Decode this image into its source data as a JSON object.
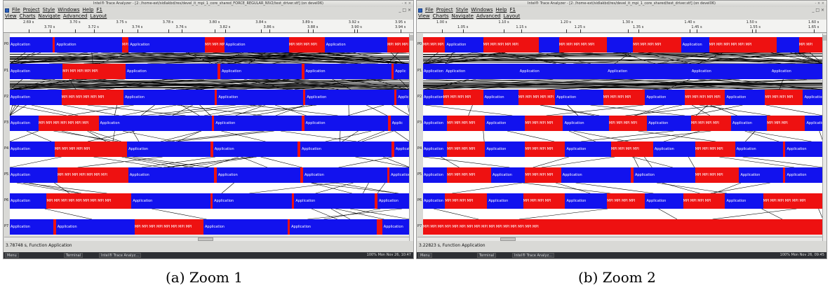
{
  "panels": [
    {
      "id": "a",
      "window_title": "Intel® Trace Analyzer - [2: /home-ext/sidlakbd/res/devel_it_mpi_1_core_shared_FORCE_REGULAR_NIV2/test_driver.stf] (on devel06)",
      "window_buttons": "- × ×",
      "menus": [
        {
          "label": "File"
        },
        {
          "label": "Project"
        },
        {
          "label": "Style"
        },
        {
          "label": "Windows"
        },
        {
          "label": "Help"
        },
        {
          "label": "F1"
        }
      ],
      "menu_right": "_ □ ×",
      "chart_menus": [
        {
          "label": "View"
        },
        {
          "label": "Charts"
        },
        {
          "label": "Navigate"
        },
        {
          "label": "Advanced"
        },
        {
          "label": "Layout"
        }
      ],
      "ruler_up": [
        "2.69 s",
        "3.70 s",
        "3.75 s",
        "3.78 s",
        "3.80 s",
        "3.84 s",
        "3.89 s",
        "3.92 s",
        "3.95 s"
      ],
      "ruler_down": [
        "3.70 s",
        "3.72 s",
        "3.74 s",
        "3.76 s",
        "3.82 s",
        "3.86 s",
        "3.88 s",
        "3.90 s",
        "3.94 s"
      ],
      "rows": [
        {
          "label": "P0",
          "segments": [
            {
              "s": 0.107,
              "e": 0.113,
              "t": ""
            },
            {
              "s": 0.281,
              "e": 0.297,
              "t": "MPI"
            },
            {
              "s": 0.488,
              "e": 0.536,
              "t": "MPI MPI MPI"
            },
            {
              "s": 0.698,
              "e": 0.787,
              "t": "MPI MPI MPI MPI"
            },
            {
              "s": 0.944,
              "e": 1.0,
              "t": "MPI MPI MPI"
            }
          ],
          "apps": [
            {
              "x": 0.0,
              "t": "Application"
            },
            {
              "x": 0.115,
              "t": "Application"
            },
            {
              "x": 0.299,
              "t": "Application"
            },
            {
              "x": 0.538,
              "t": "Application"
            },
            {
              "x": 0.789,
              "t": "Application"
            }
          ]
        },
        {
          "label": "P1",
          "segments": [
            {
              "s": 0.132,
              "e": 0.289,
              "t": "MPI MPI MPI MPI MPI"
            },
            {
              "s": 0.52,
              "e": 0.526,
              "t": ""
            },
            {
              "s": 0.73,
              "e": 0.736,
              "t": ""
            },
            {
              "s": 0.954,
              "e": 0.96,
              "t": ""
            }
          ],
          "apps": [
            {
              "x": 0.0,
              "t": "Application"
            },
            {
              "x": 0.291,
              "t": "Application"
            },
            {
              "x": 0.528,
              "t": "Application"
            },
            {
              "x": 0.738,
              "t": "Application"
            },
            {
              "x": 0.962,
              "t": "Applic"
            }
          ]
        },
        {
          "label": "P2",
          "segments": [
            {
              "s": 0.129,
              "e": 0.284,
              "t": "MPI MPI MPI MPI MPI MPI"
            },
            {
              "s": 0.512,
              "e": 0.518,
              "t": ""
            },
            {
              "s": 0.733,
              "e": 0.739,
              "t": ""
            },
            {
              "s": 0.961,
              "e": 0.967,
              "t": ""
            }
          ],
          "apps": [
            {
              "x": 0.0,
              "t": "Application"
            },
            {
              "x": 0.286,
              "t": "Application"
            },
            {
              "x": 0.52,
              "t": "Application"
            },
            {
              "x": 0.741,
              "t": "Application"
            },
            {
              "x": 0.969,
              "t": "Applic"
            }
          ]
        },
        {
          "label": "P3",
          "segments": [
            {
              "s": 0.072,
              "e": 0.222,
              "t": "MPI MPI MPI MPI MPI MPI MPI"
            },
            {
              "s": 0.505,
              "e": 0.511,
              "t": ""
            },
            {
              "s": 0.73,
              "e": 0.736,
              "t": ""
            },
            {
              "s": 0.946,
              "e": 0.952,
              "t": ""
            }
          ],
          "apps": [
            {
              "x": 0.0,
              "t": "Application"
            },
            {
              "x": 0.224,
              "t": "Application"
            },
            {
              "x": 0.513,
              "t": "Application"
            },
            {
              "x": 0.738,
              "t": "Application"
            },
            {
              "x": 0.954,
              "t": "Applic"
            }
          ]
        },
        {
          "label": "P4",
          "segments": [
            {
              "s": 0.112,
              "e": 0.293,
              "t": "MPI MPI MPI MPI MPI"
            },
            {
              "s": 0.502,
              "e": 0.508,
              "t": ""
            },
            {
              "s": 0.72,
              "e": 0.726,
              "t": ""
            },
            {
              "s": 0.955,
              "e": 0.961,
              "t": ""
            }
          ],
          "apps": [
            {
              "x": 0.0,
              "t": "Application"
            },
            {
              "x": 0.295,
              "t": "Application"
            },
            {
              "x": 0.51,
              "t": "Application"
            },
            {
              "x": 0.728,
              "t": "Application"
            },
            {
              "x": 0.963,
              "t": "Application"
            }
          ]
        },
        {
          "label": "P5",
          "segments": [
            {
              "s": 0.119,
              "e": 0.296,
              "t": "MPI MPI MPI MPI MPI MPI MPI"
            },
            {
              "s": 0.511,
              "e": 0.517,
              "t": ""
            },
            {
              "s": 0.727,
              "e": 0.733,
              "t": ""
            },
            {
              "s": 0.943,
              "e": 0.949,
              "t": ""
            }
          ],
          "apps": [
            {
              "x": 0.0,
              "t": "Application"
            },
            {
              "x": 0.298,
              "t": "Application"
            },
            {
              "x": 0.519,
              "t": "Application"
            },
            {
              "x": 0.735,
              "t": "Application"
            },
            {
              "x": 0.951,
              "t": "Application"
            }
          ]
        },
        {
          "label": "P6",
          "segments": [
            {
              "s": 0.092,
              "e": 0.304,
              "t": "MPI MPI MPI MPI MPI MPI MPI MPI MPI"
            },
            {
              "s": 0.501,
              "e": 0.507,
              "t": ""
            },
            {
              "s": 0.705,
              "e": 0.711,
              "t": ""
            },
            {
              "s": 0.913,
              "e": 0.919,
              "t": ""
            }
          ],
          "apps": [
            {
              "x": 0.0,
              "t": "Application"
            },
            {
              "x": 0.306,
              "t": "Application"
            },
            {
              "x": 0.509,
              "t": "Application"
            },
            {
              "x": 0.713,
              "t": "Application"
            },
            {
              "x": 0.921,
              "t": "Application"
            }
          ]
        },
        {
          "label": "P7",
          "segments": [
            {
              "s": 0.109,
              "e": 0.115,
              "t": ""
            },
            {
              "s": 0.312,
              "e": 0.484,
              "t": "MPI MPI MPI MPI MPI MPI MPI MPI"
            },
            {
              "s": 0.694,
              "e": 0.7,
              "t": ""
            },
            {
              "s": 0.917,
              "e": 0.931,
              "t": ""
            }
          ],
          "apps": [
            {
              "x": 0.0,
              "t": "Application"
            },
            {
              "x": 0.117,
              "t": "Application"
            },
            {
              "x": 0.486,
              "t": "Application"
            },
            {
              "x": 0.702,
              "t": "Application"
            },
            {
              "x": 0.933,
              "t": "Application"
            }
          ]
        }
      ],
      "status": "3.78748 s, Function Application",
      "taskbar": {
        "menu": "Menu",
        "terminal": "Terminal",
        "app": "Intel® Trace Analyz...",
        "clock": "Mon Nov 26, 10:47",
        "tray": "100%"
      },
      "caption": "(a) Zoom 1"
    },
    {
      "id": "b",
      "window_title": "Intel® Trace Analyzer - [2: /home-ext/sidlakbd/res/devel_it_mpi_1_core_shared/test_driver.stf] (on devel06)",
      "window_buttons": "- × ×",
      "menus": [
        {
          "label": "File"
        },
        {
          "label": "Project"
        },
        {
          "label": "Style"
        },
        {
          "label": "Windows"
        },
        {
          "label": "Help"
        },
        {
          "label": "F1"
        }
      ],
      "menu_right": "_ □ ×",
      "chart_menus": [
        {
          "label": "View"
        },
        {
          "label": "Charts"
        },
        {
          "label": "Navigate"
        },
        {
          "label": "Advanced"
        },
        {
          "label": "Layout"
        }
      ],
      "ruler_up": [
        "1.00 s",
        "1.10 s",
        "1.20 s",
        "1.30 s",
        "1.40 s",
        "1.50 s",
        "1.60 s"
      ],
      "ruler_down": [
        "1.05 s",
        "1.15 s",
        "1.25 s",
        "1.35 s",
        "1.45 s",
        "1.55 s",
        "1.65 s"
      ],
      "rows": [
        {
          "label": "P0",
          "segments": [
            {
              "s": 0.0,
              "e": 0.055,
              "t": "MPI MPI MPI"
            },
            {
              "s": 0.15,
              "e": 0.29,
              "t": "MPI MPI MPI MPI MPI"
            },
            {
              "s": 0.34,
              "e": 0.46,
              "t": "MPI MPI MPI MPI MPI"
            },
            {
              "s": 0.525,
              "e": 0.645,
              "t": "MPI MPI MPI MPI"
            },
            {
              "s": 0.715,
              "e": 0.885,
              "t": "MPI MPI MPI MPI MPI MPI"
            },
            {
              "s": 0.94,
              "e": 1.0,
              "t": "MPI MPI"
            }
          ],
          "apps": [
            {
              "x": 0.057,
              "t": "Application"
            },
            {
              "x": 0.647,
              "t": "Application"
            }
          ]
        },
        {
          "label": "P1",
          "segments": [],
          "apps": [
            {
              "x": 0.0,
              "t": "Application"
            },
            {
              "x": 0.055,
              "t": "Application"
            },
            {
              "x": 0.24,
              "t": "Application"
            },
            {
              "x": 0.46,
              "t": "Application"
            },
            {
              "x": 0.67,
              "t": "Application"
            },
            {
              "x": 0.87,
              "t": "Application"
            }
          ]
        },
        {
          "label": "P2",
          "segments": [
            {
              "s": 0.05,
              "e": 0.15,
              "t": "MPI MPI MPI MPI"
            },
            {
              "s": 0.238,
              "e": 0.33,
              "t": "MPI MPI MPI MPI MPI"
            },
            {
              "s": 0.45,
              "e": 0.555,
              "t": "MPI MPI MPI MPI"
            },
            {
              "s": 0.655,
              "e": 0.755,
              "t": "MPI MPI MPI MPI MPI"
            },
            {
              "s": 0.855,
              "e": 0.95,
              "t": "MPI MPI MPI MPI"
            }
          ],
          "apps": [
            {
              "x": 0.0,
              "t": "Application"
            },
            {
              "x": 0.152,
              "t": "Application"
            },
            {
              "x": 0.332,
              "t": "Application"
            },
            {
              "x": 0.557,
              "t": "Application"
            },
            {
              "x": 0.757,
              "t": "Application"
            },
            {
              "x": 0.952,
              "t": "Application"
            }
          ]
        },
        {
          "label": "P3",
          "segments": [
            {
              "s": 0.06,
              "e": 0.155,
              "t": "MPI MPI MPI MPI"
            },
            {
              "s": 0.255,
              "e": 0.35,
              "t": "MPI MPI MPI MPI"
            },
            {
              "s": 0.465,
              "e": 0.56,
              "t": "MPI MPI MPI MPI"
            },
            {
              "s": 0.67,
              "e": 0.77,
              "t": "MPI MPI MPI MPI"
            },
            {
              "s": 0.86,
              "e": 0.955,
              "t": "MPI MPI MPI"
            }
          ],
          "apps": [
            {
              "x": 0.0,
              "t": "Application"
            },
            {
              "x": 0.157,
              "t": "Application"
            },
            {
              "x": 0.352,
              "t": "Application"
            },
            {
              "x": 0.562,
              "t": "Application"
            },
            {
              "x": 0.772,
              "t": "Application"
            },
            {
              "x": 0.957,
              "t": "Application"
            }
          ]
        },
        {
          "label": "P4",
          "segments": [
            {
              "s": 0.06,
              "e": 0.155,
              "t": "MPI MPI MPI MPI"
            },
            {
              "s": 0.255,
              "e": 0.355,
              "t": "MPI MPI MPI MPI"
            },
            {
              "s": 0.47,
              "e": 0.575,
              "t": "MPI MPI MPI MPI"
            },
            {
              "s": 0.68,
              "e": 0.78,
              "t": "MPI MPI MPI MPI"
            },
            {
              "s": 0.9,
              "e": 0.906,
              "t": ""
            }
          ],
          "apps": [
            {
              "x": 0.0,
              "t": "Application"
            },
            {
              "x": 0.157,
              "t": "Application"
            },
            {
              "x": 0.357,
              "t": "Application"
            },
            {
              "x": 0.577,
              "t": "Application"
            },
            {
              "x": 0.782,
              "t": "Application"
            },
            {
              "x": 0.908,
              "t": "Application"
            }
          ]
        },
        {
          "label": "P5",
          "segments": [
            {
              "s": 0.06,
              "e": 0.17,
              "t": "MPI MPI MPI MPI"
            },
            {
              "s": 0.255,
              "e": 0.345,
              "t": "MPI MPI MPI MPI"
            },
            {
              "s": 0.52,
              "e": 0.526,
              "t": ""
            },
            {
              "s": 0.68,
              "e": 0.79,
              "t": "MPI MPI MPI MPI"
            },
            {
              "s": 0.9,
              "e": 0.906,
              "t": ""
            }
          ],
          "apps": [
            {
              "x": 0.0,
              "t": "Application"
            },
            {
              "x": 0.172,
              "t": "Application"
            },
            {
              "x": 0.347,
              "t": "Application"
            },
            {
              "x": 0.528,
              "t": "Application"
            },
            {
              "x": 0.792,
              "t": "Application"
            },
            {
              "x": 0.908,
              "t": "Application"
            }
          ]
        },
        {
          "label": "P6",
          "segments": [
            {
              "s": 0.055,
              "e": 0.16,
              "t": "MPI MPI MPI MPI"
            },
            {
              "s": 0.25,
              "e": 0.355,
              "t": "MPI MPI MPI MPI"
            },
            {
              "s": 0.46,
              "e": 0.555,
              "t": "MPI MPI MPI MPI"
            },
            {
              "s": 0.65,
              "e": 0.755,
              "t": "MPI MPI MPI MPI"
            },
            {
              "s": 0.85,
              "e": 1.0,
              "t": "MPI MPI MPI MPI MPI MPI"
            }
          ],
          "apps": [
            {
              "x": 0.0,
              "t": "Application"
            },
            {
              "x": 0.162,
              "t": "Application"
            },
            {
              "x": 0.357,
              "t": "Application"
            },
            {
              "x": 0.557,
              "t": "Application"
            },
            {
              "x": 0.757,
              "t": "Application"
            }
          ]
        },
        {
          "label": "P7",
          "segments": [
            {
              "s": 0.0,
              "e": 1.0,
              "t": "MPI MPI MPI MPI MPI MPI MPI MPI MPI MPI MPI MPI MPI MPI MPI MPI"
            }
          ],
          "apps": []
        }
      ],
      "status": "3.22823 s, Function Application",
      "taskbar": {
        "menu": "Menu",
        "terminal": "Terminal",
        "app": "Intel® Trace Analyz...",
        "clock": "Mon Nov 26, 09:45",
        "tray": "100%"
      },
      "caption": "(b) Zoom 2"
    }
  ]
}
